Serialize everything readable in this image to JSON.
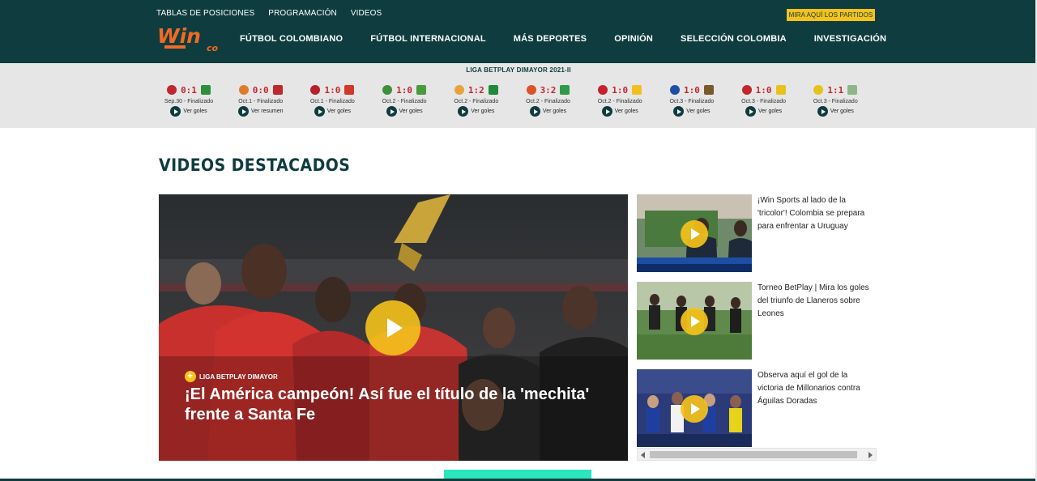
{
  "header": {
    "top_links": [
      "TABLAS DE POSICIONES",
      "PROGRAMACIÓN",
      "VIDEOS"
    ],
    "cta_label": "MIRA AQUÍ LOS PARTIDOS",
    "logo_text": "Win",
    "logo_sub": "co",
    "main_nav": [
      "FÚTBOL COLOMBIANO",
      "FÚTBOL INTERNACIONAL",
      "MÁS DEPORTES",
      "OPINIÓN",
      "SELECCIÓN COLOMBIA",
      "INVESTIGACIÓN"
    ],
    "colors": {
      "bg": "#0e3c3f",
      "accent": "#f4c21b",
      "logo": "#f26a21"
    }
  },
  "scores": {
    "league": "LIGA BETPLAY DIMAYOR 2021-II",
    "matches": [
      {
        "score": "0:1",
        "date": "Sep.30 - Finalizado",
        "link": "Ver goles",
        "home_color": "#c1272d",
        "away_color": "#2f8f3e"
      },
      {
        "score": "0:0",
        "date": "Oct.1 - Finalizado",
        "link": "Ver resumen",
        "home_color": "#e07b2a",
        "away_color": "#c1272d"
      },
      {
        "score": "1:0",
        "date": "Oct.1 - Finalizado",
        "link": "Ver goles",
        "home_color": "#b81f2d",
        "away_color": "#d2382a"
      },
      {
        "score": "1:0",
        "date": "Oct.2 - Finalizado",
        "link": "Ver goles",
        "home_color": "#3f8e3a",
        "away_color": "#4a9b3b"
      },
      {
        "score": "1:2",
        "date": "Oct.2 - Finalizado",
        "link": "Ver goles",
        "home_color": "#e9a23b",
        "away_color": "#1f8a3a"
      },
      {
        "score": "3:2",
        "date": "Oct.2 - Finalizado",
        "link": "Ver goles",
        "home_color": "#e0502a",
        "away_color": "#2f9a4a"
      },
      {
        "score": "1:0",
        "date": "Oct.2 - Finalizado",
        "link": "Ver goles",
        "home_color": "#c8202e",
        "away_color": "#f2c01e"
      },
      {
        "score": "1:0",
        "date": "Oct.3 - Finalizado",
        "link": "Ver goles",
        "home_color": "#1f4ea8",
        "away_color": "#7a5a2a"
      },
      {
        "score": "1:0",
        "date": "Oct.3 - Finalizado",
        "link": "Ver goles",
        "home_color": "#c1272d",
        "away_color": "#e6c21a"
      },
      {
        "score": "1:1",
        "date": "Oct.3 - Finalizado",
        "link": "Ver goles",
        "home_color": "#e6c21a",
        "away_color": "#8fb58a"
      }
    ]
  },
  "main": {
    "section_title": "VIDEOS DESTACADOS",
    "hero": {
      "tag": "LIGA BETPLAY DIMAYOR",
      "title": "¡El América campeón! Así fue el título de la 'mechita' frente a Santa Fe"
    },
    "side_videos": [
      {
        "title": "¡Win Sports al lado de la 'tricolor'! Colombia se prepara para enfrentar a Uruguay"
      },
      {
        "title": "Torneo BetPlay | Mira los goles del triunfo de Llaneros sobre Leones"
      },
      {
        "title": "Observa aquí el gol de la victoria de Millonarios contra Águilas Doradas"
      }
    ]
  }
}
